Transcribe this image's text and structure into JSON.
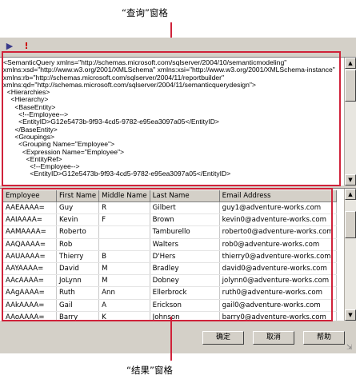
{
  "callouts": {
    "top": "“查询”窗格",
    "bottom": "“结果”窗格"
  },
  "colors": {
    "highlight": "#d0223a",
    "dialog_bg": "#d4d0c8"
  },
  "toolbar": {
    "run_icon": "run-query-icon",
    "exclaim_icon": "exclamation-icon",
    "exclaim_glyph": "!"
  },
  "query_text": "<SemanticQuery xmlns=\"http://schemas.microsoft.com/sqlserver/2004/10/semanticmodeling\"\nxmlns:xsd=\"http://www.w3.org/2001/XMLSchema\" xmlns:xsi=\"http://www.w3.org/2001/XMLSchema-instance\"\nxmlns:rb=\"http://schemas.microsoft.com/sqlserver/2004/11/reportbuilder\"\nxmlns:qd=\"http://schemas.microsoft.com/sqlserver/2004/11/semanticquerydesign\">\n  <Hierarchies>\n    <Hierarchy>\n      <BaseEntity>\n        <!--Employee-->\n        <EntityID>G12e5473b-9f93-4cd5-9782-e95ea3097a05</EntityID>\n      </BaseEntity>\n      <Groupings>\n        <Grouping Name=\"Employee\">\n          <Expression Name=\"Employee\">\n            <EntityRef>\n              <!--Employee-->\n              <EntityID>G12e5473b-9f93-4cd5-9782-e95ea3097a05</EntityID>",
  "results": {
    "columns": [
      "Employee",
      "First Name",
      "Middle Name",
      "Last Name",
      "Email Address"
    ],
    "rows": [
      [
        "AAEAAAA=",
        "Guy",
        "R",
        "Gilbert",
        "guy1@adventure-works.com"
      ],
      [
        "AAIAAAA=",
        "Kevin",
        "F",
        "Brown",
        "kevin0@adventure-works.com"
      ],
      [
        "AAMAAAA=",
        "Roberto",
        "",
        "Tamburello",
        "roberto0@adventure-works.com"
      ],
      [
        "AAQAAAA=",
        "Rob",
        "",
        "Walters",
        "rob0@adventure-works.com"
      ],
      [
        "AAUAAAA=",
        "Thierry",
        "B",
        "D'Hers",
        "thierry0@adventure-works.com"
      ],
      [
        "AAYAAAA=",
        "David",
        "M",
        "Bradley",
        "david0@adventure-works.com"
      ],
      [
        "AAcAAAA=",
        "JoLynn",
        "M",
        "Dobney",
        "jolynn0@adventure-works.com"
      ],
      [
        "AAgAAAA=",
        "Ruth",
        "Ann",
        "Ellerbrock",
        "ruth0@adventure-works.com"
      ],
      [
        "AAkAAAA=",
        "Gail",
        "A",
        "Erickson",
        "gail0@adventure-works.com"
      ],
      [
        "AAoAAAA=",
        "Barry",
        "K",
        "Johnson",
        "barry0@adventure-works.com"
      ]
    ]
  },
  "buttons": {
    "ok": "确定",
    "cancel": "取消",
    "help": "帮助"
  }
}
